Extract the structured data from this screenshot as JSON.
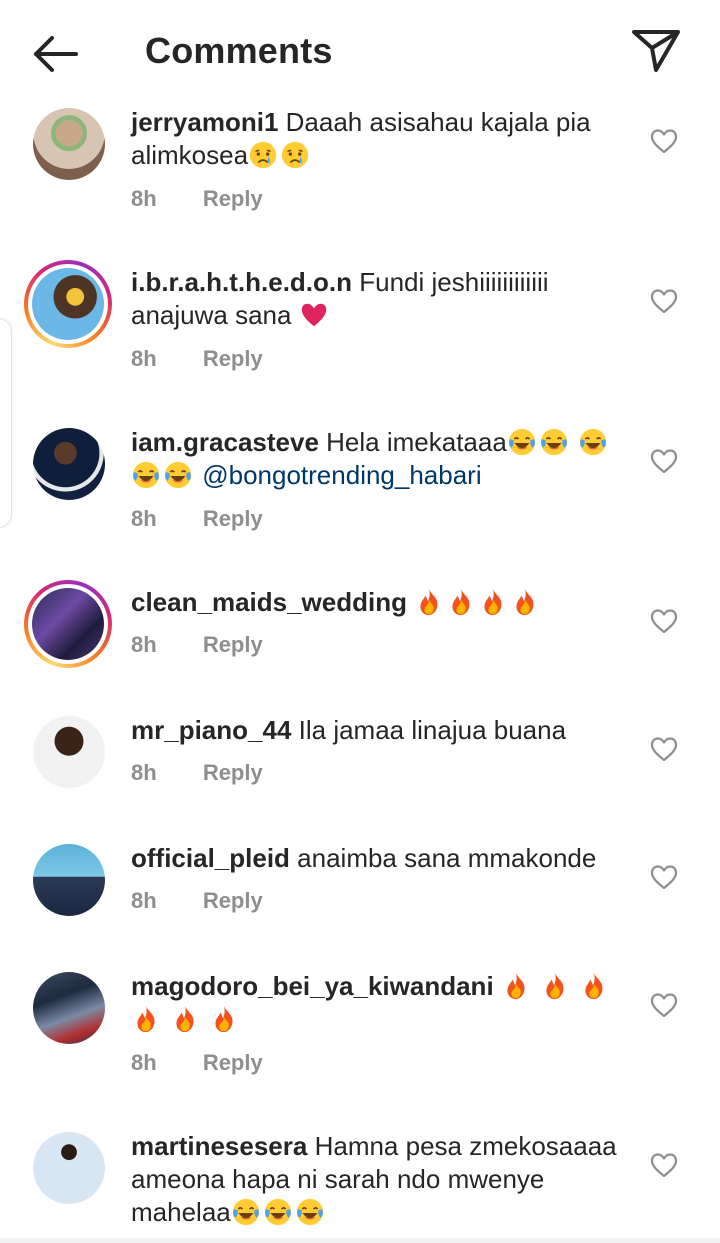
{
  "header": {
    "title": "Comments",
    "back_icon": "arrow-left-icon",
    "send_icon": "paper-plane-icon"
  },
  "colors": {
    "text": "#262626",
    "muted": "#8e8e8e",
    "mention": "#00376b",
    "like": "#8e8e8e"
  },
  "comments": [
    {
      "username": "jerryamoni1",
      "text": "Daaah asisahau kajala pia alimkosea",
      "emojis_after": [
        "crying-face",
        "crying-face"
      ],
      "time": "8h",
      "reply": "Reply",
      "story_ring": false
    },
    {
      "username": "i.b.r.a.h.t.h.e.d.o.n",
      "text": "Fundi jeshiiiiiiiiiiii anajuwa sana",
      "emojis_after": [
        "red-heart"
      ],
      "time": "8h",
      "reply": "Reply",
      "story_ring": true
    },
    {
      "username": "iam.gracasteve",
      "text": "Hela imekataaa",
      "emojis_after": [
        "tears-of-joy",
        "tears-of-joy",
        "tears-of-joy",
        "tears-of-joy",
        "tears-of-joy"
      ],
      "mention": "@bongotrending_habari",
      "time": "8h",
      "reply": "Reply",
      "story_ring": false
    },
    {
      "username": "clean_maids_wedding",
      "text": "",
      "emojis_after": [
        "fire",
        "fire",
        "fire",
        "fire"
      ],
      "time": "8h",
      "reply": "Reply",
      "story_ring": true
    },
    {
      "username": "mr_piano_44",
      "text": "Ila jamaa linajua buana",
      "emojis_after": [],
      "time": "8h",
      "reply": "Reply",
      "story_ring": false
    },
    {
      "username": "official_pleid",
      "text": "anaimba sana mmakonde",
      "emojis_after": [],
      "time": "8h",
      "reply": "Reply",
      "story_ring": false
    },
    {
      "username": "magodoro_bei_ya_kiwandani",
      "text": "",
      "emojis_after": [
        "fire",
        "fire",
        "fire",
        "fire",
        "fire",
        "fire"
      ],
      "time": "8h",
      "reply": "Reply",
      "story_ring": false
    },
    {
      "username": "martinesesera",
      "text": "Hamna pesa zmekosaaaa ameona hapa ni sarah ndo mwenye mahelaa",
      "emojis_after": [
        "tears-of-joy",
        "tears-of-joy",
        "tears-of-joy"
      ],
      "time": "",
      "reply": "",
      "story_ring": false
    }
  ]
}
